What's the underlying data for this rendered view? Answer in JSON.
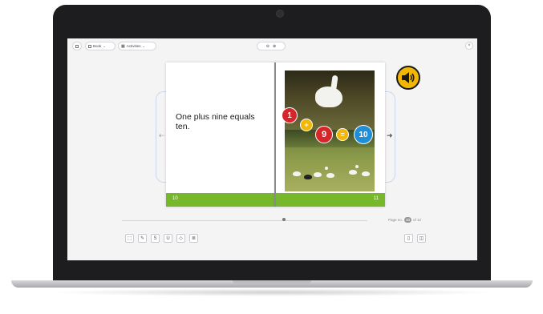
{
  "toolbar": {
    "book_label": "Book",
    "activities_label": "Activities",
    "close_glyph": "×"
  },
  "book": {
    "left_page": {
      "sentence": "One plus nine equals ten.",
      "page_number": "10"
    },
    "right_page": {
      "page_number": "11",
      "equation": {
        "a": "1",
        "plus": "+",
        "b": "9",
        "equals": "=",
        "result": "10"
      }
    }
  },
  "pager": {
    "label": "Page no.",
    "current": "10",
    "total_text": "of 12"
  },
  "colors": {
    "accent_green": "#76b82a",
    "speaker_yellow": "#f2b705",
    "circle_red": "#d6262a",
    "circle_yellow": "#f2b705",
    "circle_blue": "#1f8ed6"
  },
  "icons": {
    "side_nav": [
      "arrow-left-icon",
      "arrow-right-icon"
    ],
    "tools": [
      "select-icon",
      "highlight-icon",
      "strike-icon",
      "underline-icon",
      "eraser-icon",
      "notes-icon"
    ],
    "view": [
      "single-page-icon",
      "double-page-icon"
    ]
  }
}
